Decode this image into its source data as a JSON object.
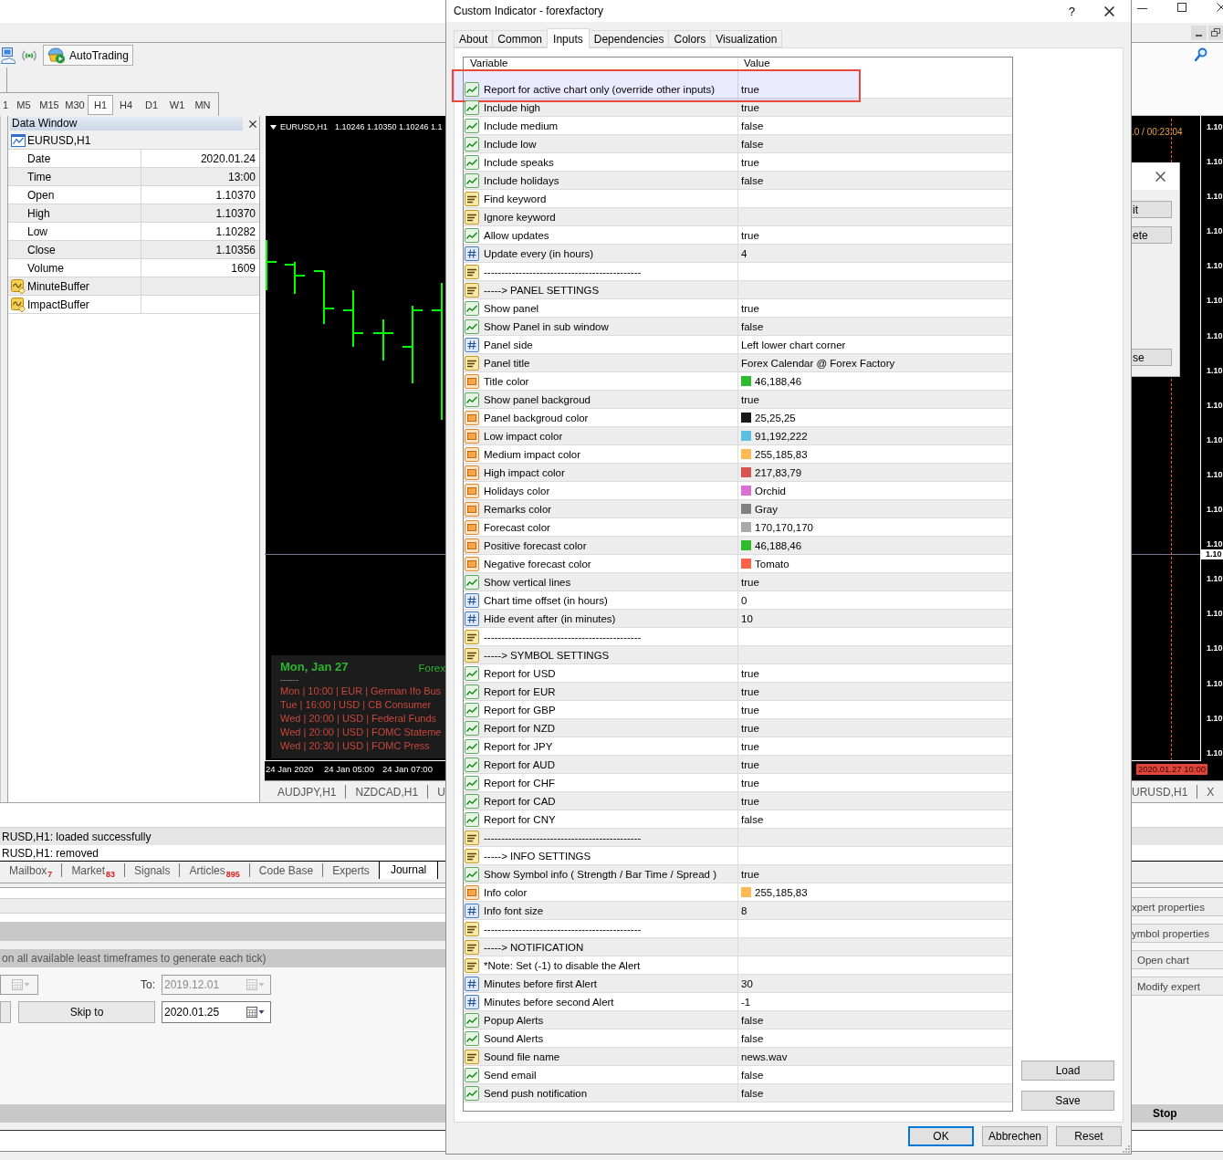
{
  "terminal": {
    "autotrading": "AutoTrading",
    "timeframes": [
      {
        "label": "1",
        "selected": false
      },
      {
        "label": "M5",
        "selected": false
      },
      {
        "label": "M15",
        "selected": false
      },
      {
        "label": "M30",
        "selected": false
      },
      {
        "label": "H1",
        "selected": true
      },
      {
        "label": "H4",
        "selected": false
      },
      {
        "label": "D1",
        "selected": false
      },
      {
        "label": "W1",
        "selected": false
      },
      {
        "label": "MN",
        "selected": false
      }
    ],
    "data_window": {
      "title": "Data Window",
      "symbol": "EURUSD,H1",
      "rows": [
        {
          "name": "Date",
          "value": "2020.01.24"
        },
        {
          "name": "Time",
          "value": "13:00"
        },
        {
          "name": "Open",
          "value": "1.10370"
        },
        {
          "name": "High",
          "value": "1.10370"
        },
        {
          "name": "Low",
          "value": "1.10282"
        },
        {
          "name": "Close",
          "value": "1.10356"
        },
        {
          "name": "Volume",
          "value": "1609"
        }
      ],
      "buffers": [
        "MinuteBuffer",
        "ImpactBuffer"
      ]
    },
    "chart": {
      "symbol": "EURUSD,H1",
      "prices": "1.10246 1.10350 1.10246 1.1",
      "countdown": ".0 / 00:23:04",
      "price_labels": [
        "1.10",
        "1.10",
        "1.10",
        "1.10",
        "1.10",
        "1.10",
        "1.10",
        "1.10",
        "1.10",
        "1.10",
        "1.10",
        "1.10",
        "1.10",
        "1.10",
        "1.10",
        "1.10",
        "1.10",
        "1.10",
        "1.10"
      ],
      "current_price": "1.10",
      "time_labels": [
        "24 Jan 2020",
        "24 Jan 05:00",
        "24 Jan 07:00"
      ],
      "line_time": "2020.01.27 10:00",
      "calendar": {
        "date": "Mon, Jan 27",
        "source": "Forex",
        "divider": "------",
        "events": [
          "Mon | 10:00 | EUR | German Ifo Bus",
          "Tue | 16:00 | USD | CB Consumer",
          "Wed | 20:00 | USD | Federal Funds",
          "Wed | 20:00 | USD | FOMC Stateme",
          "Wed | 20:30 | USD | FOMC Press"
        ]
      },
      "edit_dialog_buttons": [
        "it",
        "ete",
        "se"
      ]
    },
    "chart_tabs_left": [
      "AUDJPY,H1",
      "NZDCAD,H1",
      "U"
    ],
    "chart_tabs_right": [
      "URUSD,H1",
      "X"
    ],
    "journal": [
      "RUSD,H1: loaded successfully",
      "RUSD,H1: removed"
    ],
    "panel_tabs": [
      {
        "label": "Mailbox",
        "count": "7",
        "selected": false
      },
      {
        "label": "Market",
        "count": "83",
        "selected": false
      },
      {
        "label": "Signals",
        "selected": false
      },
      {
        "label": "Articles",
        "count": "895",
        "selected": false
      },
      {
        "label": "Code Base",
        "selected": false
      },
      {
        "label": "Experts",
        "selected": false
      },
      {
        "label": "Journal",
        "selected": true
      }
    ],
    "tester": {
      "hint": "on all available least timeframes to generate each tick)",
      "from_field": {
        "disabled": true
      },
      "to_label": "To:",
      "to_field": {
        "value": "2019.12.01",
        "disabled": true
      },
      "skip_button": "Skip to",
      "skip_field": {
        "value": "2020.01.25",
        "disabled": false
      },
      "side_buttons": [
        "xpert properties",
        "ymbol properties",
        "Open chart",
        "Modify expert"
      ],
      "stop_button": "Stop"
    }
  },
  "dialog": {
    "title": "Custom Indicator - forexfactory",
    "help": "?",
    "tabs": [
      {
        "label": "About",
        "selected": false
      },
      {
        "label": "Common",
        "selected": false
      },
      {
        "label": "Inputs",
        "selected": true
      },
      {
        "label": "Dependencies",
        "selected": false
      },
      {
        "label": "Colors",
        "selected": false
      },
      {
        "label": "Visualization",
        "selected": false
      }
    ],
    "columns": [
      "Variable",
      "Value"
    ],
    "params": [
      {
        "kind": "bool",
        "name": "Report for active chart only (override other inputs)",
        "value": "true"
      },
      {
        "kind": "bool",
        "name": "Include high",
        "value": "true"
      },
      {
        "kind": "bool",
        "name": "Include medium",
        "value": "false"
      },
      {
        "kind": "bool",
        "name": "Include low",
        "value": "false"
      },
      {
        "kind": "bool",
        "name": "Include speaks",
        "value": "true"
      },
      {
        "kind": "bool",
        "name": "Include holidays",
        "value": "false"
      },
      {
        "kind": "text",
        "name": "Find keyword"
      },
      {
        "kind": "text",
        "name": "Ignore keyword"
      },
      {
        "kind": "bool",
        "name": "Allow updates",
        "value": "true"
      },
      {
        "kind": "number",
        "name": "Update every (in hours)",
        "value": "4"
      },
      {
        "kind": "text",
        "name": "---------------------------------------------"
      },
      {
        "kind": "text",
        "name": "-----> PANEL SETTINGS"
      },
      {
        "kind": "bool",
        "name": "Show panel",
        "value": "true"
      },
      {
        "kind": "bool",
        "name": "Show Panel in sub window",
        "value": "false"
      },
      {
        "kind": "number",
        "name": "Panel side",
        "value": "Left lower chart corner"
      },
      {
        "kind": "text",
        "name": "Panel title",
        "value": "Forex Calendar @ Forex Factory"
      },
      {
        "kind": "color",
        "name": "Title color",
        "value": "46,188,46",
        "color": "#2ebc2e"
      },
      {
        "kind": "bool",
        "name": "Show panel backgroud",
        "value": "true"
      },
      {
        "kind": "color",
        "name": "Panel backgroud color",
        "value": "25,25,25",
        "color": "#191919"
      },
      {
        "kind": "color",
        "name": "Low impact color",
        "value": "91,192,222",
        "color": "#5bc0de"
      },
      {
        "kind": "color",
        "name": "Medium impact color",
        "value": "255,185,83",
        "color": "#ffb953"
      },
      {
        "kind": "color",
        "name": "High impact color",
        "value": "217,83,79",
        "color": "#d9534f"
      },
      {
        "kind": "color",
        "name": "Holidays color",
        "value": "Orchid",
        "color": "#da70d6"
      },
      {
        "kind": "color",
        "name": "Remarks color",
        "value": "Gray",
        "color": "#808080"
      },
      {
        "kind": "color",
        "name": "Forecast color",
        "value": "170,170,170",
        "color": "#aaaaaa"
      },
      {
        "kind": "color",
        "name": "Positive forecast color",
        "value": "46,188,46",
        "color": "#2ebc2e"
      },
      {
        "kind": "color",
        "name": "Negative forecast color",
        "value": "Tomato",
        "color": "#ff6347"
      },
      {
        "kind": "bool",
        "name": "Show vertical lines",
        "value": "true"
      },
      {
        "kind": "number",
        "name": "Chart time offset (in hours)",
        "value": "0"
      },
      {
        "kind": "number",
        "name": "Hide event after (in minutes)",
        "value": "10"
      },
      {
        "kind": "text",
        "name": "---------------------------------------------"
      },
      {
        "kind": "text",
        "name": "-----> SYMBOL SETTINGS"
      },
      {
        "kind": "bool",
        "name": "Report for USD",
        "value": "true"
      },
      {
        "kind": "bool",
        "name": "Report for EUR",
        "value": "true"
      },
      {
        "kind": "bool",
        "name": "Report for GBP",
        "value": "true"
      },
      {
        "kind": "bool",
        "name": "Report for NZD",
        "value": "true"
      },
      {
        "kind": "bool",
        "name": "Report for JPY",
        "value": "true"
      },
      {
        "kind": "bool",
        "name": "Report for AUD",
        "value": "true"
      },
      {
        "kind": "bool",
        "name": "Report for CHF",
        "value": "true"
      },
      {
        "kind": "bool",
        "name": "Report for CAD",
        "value": "true"
      },
      {
        "kind": "bool",
        "name": "Report for CNY",
        "value": "false"
      },
      {
        "kind": "text",
        "name": "---------------------------------------------"
      },
      {
        "kind": "text",
        "name": "-----> INFO SETTINGS"
      },
      {
        "kind": "bool",
        "name": "Show Symbol info ( Strength / Bar Time / Spread )",
        "value": "true"
      },
      {
        "kind": "color",
        "name": "Info color",
        "value": "255,185,83",
        "color": "#ffb953"
      },
      {
        "kind": "number",
        "name": "Info font size",
        "value": "8"
      },
      {
        "kind": "text",
        "name": "---------------------------------------------"
      },
      {
        "kind": "text",
        "name": "-----> NOTIFICATION"
      },
      {
        "kind": "text",
        "name": "*Note: Set (-1) to disable the Alert"
      },
      {
        "kind": "number",
        "name": "Minutes before first Alert",
        "value": "30"
      },
      {
        "kind": "number",
        "name": "Minutes before second Alert",
        "value": "-1"
      },
      {
        "kind": "bool",
        "name": "Popup Alerts",
        "value": "false"
      },
      {
        "kind": "bool",
        "name": "Sound Alerts",
        "value": "false"
      },
      {
        "kind": "text",
        "name": "Sound file name",
        "value": "news.wav"
      },
      {
        "kind": "bool",
        "name": "Send email",
        "value": "false"
      },
      {
        "kind": "bool",
        "name": "Send push notification",
        "value": "false"
      }
    ],
    "side_buttons": [
      "Load",
      "Save"
    ],
    "buttons": [
      {
        "label": "OK",
        "default": true
      },
      {
        "label": "Abbrechen",
        "default": false
      },
      {
        "label": "Reset",
        "default": false
      }
    ]
  }
}
